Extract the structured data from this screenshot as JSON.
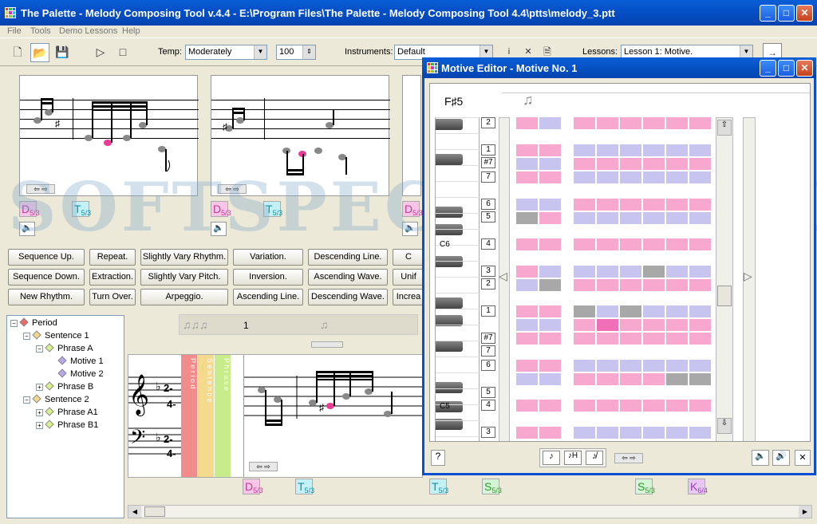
{
  "window": {
    "title": "The Palette - Melody Composing Tool v.4.4 - E:\\Program Files\\The Palette - Melody Composing Tool 4.4\\ptts\\melody_3.ptt"
  },
  "menu": [
    "File",
    "Tools",
    "Demo Lessons",
    "Help"
  ],
  "toolbar": {
    "temp_label": "Temp:",
    "temp_value": "Moderately",
    "tempo_value": "100",
    "instruments_label": "Instruments:",
    "instruments_value": "Default",
    "lessons_label": "Lessons:",
    "lessons_value": "Lesson 1: Motive."
  },
  "motive_tags": [
    {
      "letter": "D",
      "sub": "5/3"
    },
    {
      "letter": "T",
      "sub": "5/3"
    },
    {
      "letter": "D",
      "sub": "5/3"
    },
    {
      "letter": "T",
      "sub": "5/3"
    },
    {
      "letter": "D",
      "sub": "5/3"
    }
  ],
  "transform_buttons": [
    [
      "Sequence Up.",
      "Repeat.",
      "Slightly Vary Rhythm.",
      "Variation.",
      "Descending Line.",
      "C"
    ],
    [
      "Sequence Down.",
      "Extraction.",
      "Slightly Vary Pitch.",
      "Inversion.",
      "Ascending Wave.",
      "Unif"
    ],
    [
      "New Rhythm.",
      "Turn Over.",
      "Arpeggio.",
      "Ascending Line.",
      "Descending Wave.",
      "Increa"
    ]
  ],
  "tree": [
    {
      "label": "Period",
      "level": 0,
      "color": "#e86b6b"
    },
    {
      "label": "Sentence 1",
      "level": 1,
      "color": "#f0d890"
    },
    {
      "label": "Phrase A",
      "level": 2,
      "color": "#d8f090"
    },
    {
      "label": "Motive 1",
      "level": 3,
      "color": "#b8a8e8"
    },
    {
      "label": "Motive 2",
      "level": 3,
      "color": "#b8a8e8"
    },
    {
      "label": "Phrase B",
      "level": 2,
      "color": "#d8f090"
    },
    {
      "label": "Sentence 2",
      "level": 1,
      "color": "#f0d890"
    },
    {
      "label": "Phrase A1",
      "level": 2,
      "color": "#d8f090"
    },
    {
      "label": "Phrase B1",
      "level": 2,
      "color": "#d8f090"
    }
  ],
  "score": {
    "measure_number": "1",
    "track_labels": [
      "P e r i o d",
      "S e n t e n c e",
      "P h r a s e"
    ],
    "key_sig_top": "2-",
    "key_sig_top2": "4-",
    "key_sig_bot": "2-",
    "key_sig_bot2": "4-"
  },
  "bottom_tags": [
    {
      "letter": "D",
      "sub": "5/3",
      "color": "pink"
    },
    {
      "letter": "T",
      "sub": "5/3",
      "color": "cyan"
    },
    {
      "letter": "T",
      "sub": "5/3",
      "color": "cyan"
    },
    {
      "letter": "S",
      "sub": "5/3",
      "color": "green"
    },
    {
      "letter": "S",
      "sub": "5/3",
      "color": "green"
    },
    {
      "letter": "K",
      "sub": "6/4",
      "color": "purple"
    }
  ],
  "motive_editor": {
    "title": "Motive Editor - Motive No. 1",
    "note_name": "F♯5",
    "octave_labels": [
      "C6",
      "C5"
    ],
    "degree_labels": [
      "2",
      "1",
      "#7",
      "7",
      "6",
      "5",
      "4",
      "3",
      "2",
      "1",
      "#7",
      "7",
      "6",
      "5",
      "4",
      "3"
    ]
  },
  "watermark": "SOFTSPECIALIST.COM"
}
